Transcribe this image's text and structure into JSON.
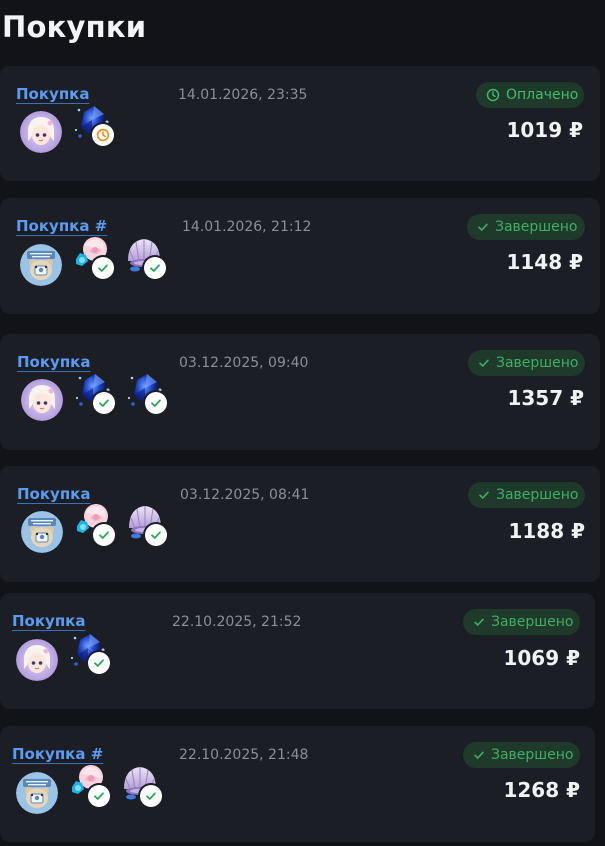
{
  "page": {
    "title": "Покупки"
  },
  "purchases": [
    {
      "label": "Покупка",
      "date": "14.01.2026, 23:35",
      "status": "Оплачено",
      "status_type": "paid",
      "price": "1019 ₽",
      "avatar": "girl-avatar",
      "items": [
        {
          "kind": "blue-crystal-icon",
          "state": "pending"
        }
      ]
    },
    {
      "label": "Покупка #",
      "date": "14.01.2026, 21:12",
      "status": "Завершено",
      "status_type": "done",
      "price": "1148 ₽",
      "avatar": "bear-avatar",
      "items": [
        {
          "kind": "rose-icon",
          "state": "done"
        },
        {
          "kind": "shell-icon",
          "state": "done"
        }
      ]
    },
    {
      "label": "Покупка",
      "date": "03.12.2025, 09:40",
      "status": "Завершено",
      "status_type": "done",
      "price": "1357 ₽",
      "avatar": "girl-avatar",
      "items": [
        {
          "kind": "blue-crystal-icon",
          "state": "done"
        },
        {
          "kind": "blue-crystal-icon",
          "state": "done"
        }
      ]
    },
    {
      "label": "Покупка",
      "date": "03.12.2025, 08:41",
      "status": "Завершено",
      "status_type": "done",
      "price": "1188 ₽",
      "avatar": "bear-avatar",
      "items": [
        {
          "kind": "rose-icon",
          "state": "done"
        },
        {
          "kind": "shell-icon",
          "state": "done"
        }
      ]
    },
    {
      "label": "Покупка",
      "date": "22.10.2025, 21:52",
      "status": "Завершено",
      "status_type": "done",
      "price": "1069 ₽",
      "avatar": "girl-avatar",
      "items": [
        {
          "kind": "blue-crystal-icon",
          "state": "done"
        }
      ]
    },
    {
      "label": "Покупка #",
      "date": "22.10.2025, 21:48",
      "status": "Завершено",
      "status_type": "done",
      "price": "1268 ₽",
      "avatar": "bear-avatar",
      "items": [
        {
          "kind": "rose-icon",
          "state": "done"
        },
        {
          "kind": "shell-icon",
          "state": "done"
        }
      ]
    }
  ]
}
